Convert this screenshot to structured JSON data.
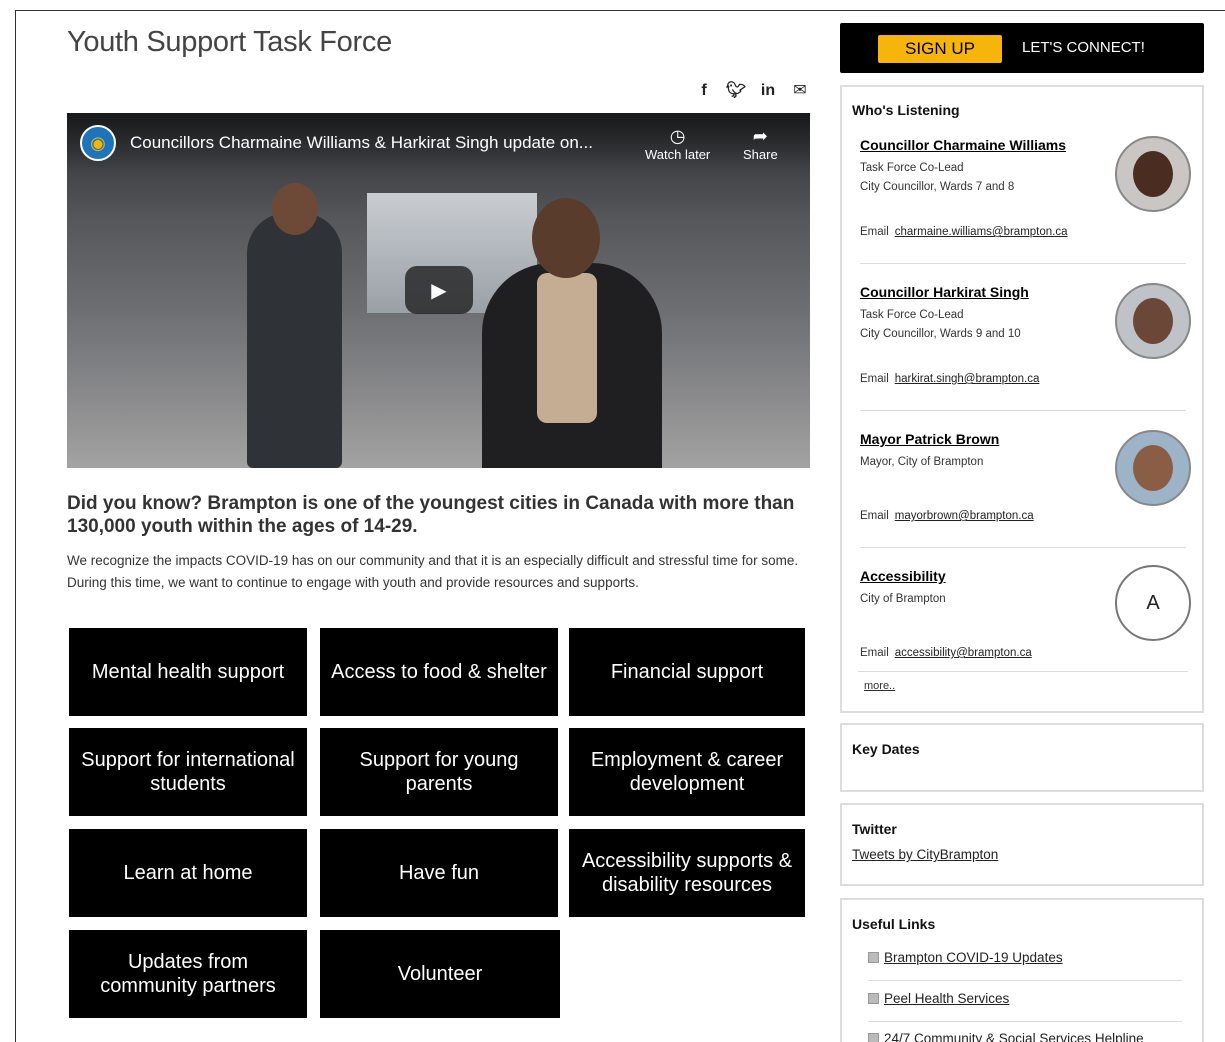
{
  "page": {
    "title": "Youth Support Task Force"
  },
  "share": {
    "icons": [
      "facebook-icon",
      "twitter-icon",
      "linkedin-icon",
      "email-icon"
    ]
  },
  "video": {
    "title": "Councillors Charmaine Williams & Harkirat Singh update on...",
    "watch_later": "Watch later",
    "share": "Share"
  },
  "content": {
    "headline": "Did you know? Brampton is one of the youngest cities in Canada with more than 130,000 youth within the ages of 14-29.",
    "intro": "We recognize the impacts COVID-19 has on our community and that it is an especially difficult and stressful time for some. During this time, we want to continue to engage with youth and provide resources and supports."
  },
  "tiles": [
    "Mental health support",
    "Access to food & shelter",
    "Financial support",
    "Support for international students",
    "Support for young parents",
    "Employment & career development",
    "Learn at home",
    "Have fun",
    "Accessibility supports & disability resources",
    "Updates from community partners",
    "Volunteer"
  ],
  "sidebar": {
    "signup": "SIGN UP",
    "connect": "LET'S CONNECT!",
    "whos_listening": {
      "heading": "Who's Listening",
      "people": [
        {
          "name": "Councillor Charmaine Williams",
          "line1": "Task Force Co-Lead",
          "line2": "City Councillor, Wards 7 and 8",
          "email_label": "Email",
          "email": "charmaine.williams@brampton.ca"
        },
        {
          "name": "Councillor Harkirat Singh",
          "line1": "Task Force Co-Lead",
          "line2": "City Councillor, Wards 9 and 10",
          "email_label": "Email",
          "email": "harkirat.singh@brampton.ca"
        },
        {
          "name": "Mayor Patrick Brown",
          "line1": "Mayor, City of Brampton",
          "email_label": "Email",
          "email": "mayorbrown@brampton.ca"
        },
        {
          "name": "Accessibility",
          "line1": "City of Brampton",
          "avatar_letter": "A",
          "email_label": "Email",
          "email": "accessibility@brampton.ca"
        }
      ],
      "more": "more.."
    },
    "key_dates": {
      "heading": "Key Dates"
    },
    "twitter": {
      "heading": "Twitter",
      "link": "Tweets by CityBrampton"
    },
    "useful_links": {
      "heading": "Useful Links",
      "items": [
        "Brampton COVID-19 Updates",
        "Peel Health Services",
        "24/7 Community & Social Services Helpline"
      ]
    }
  }
}
